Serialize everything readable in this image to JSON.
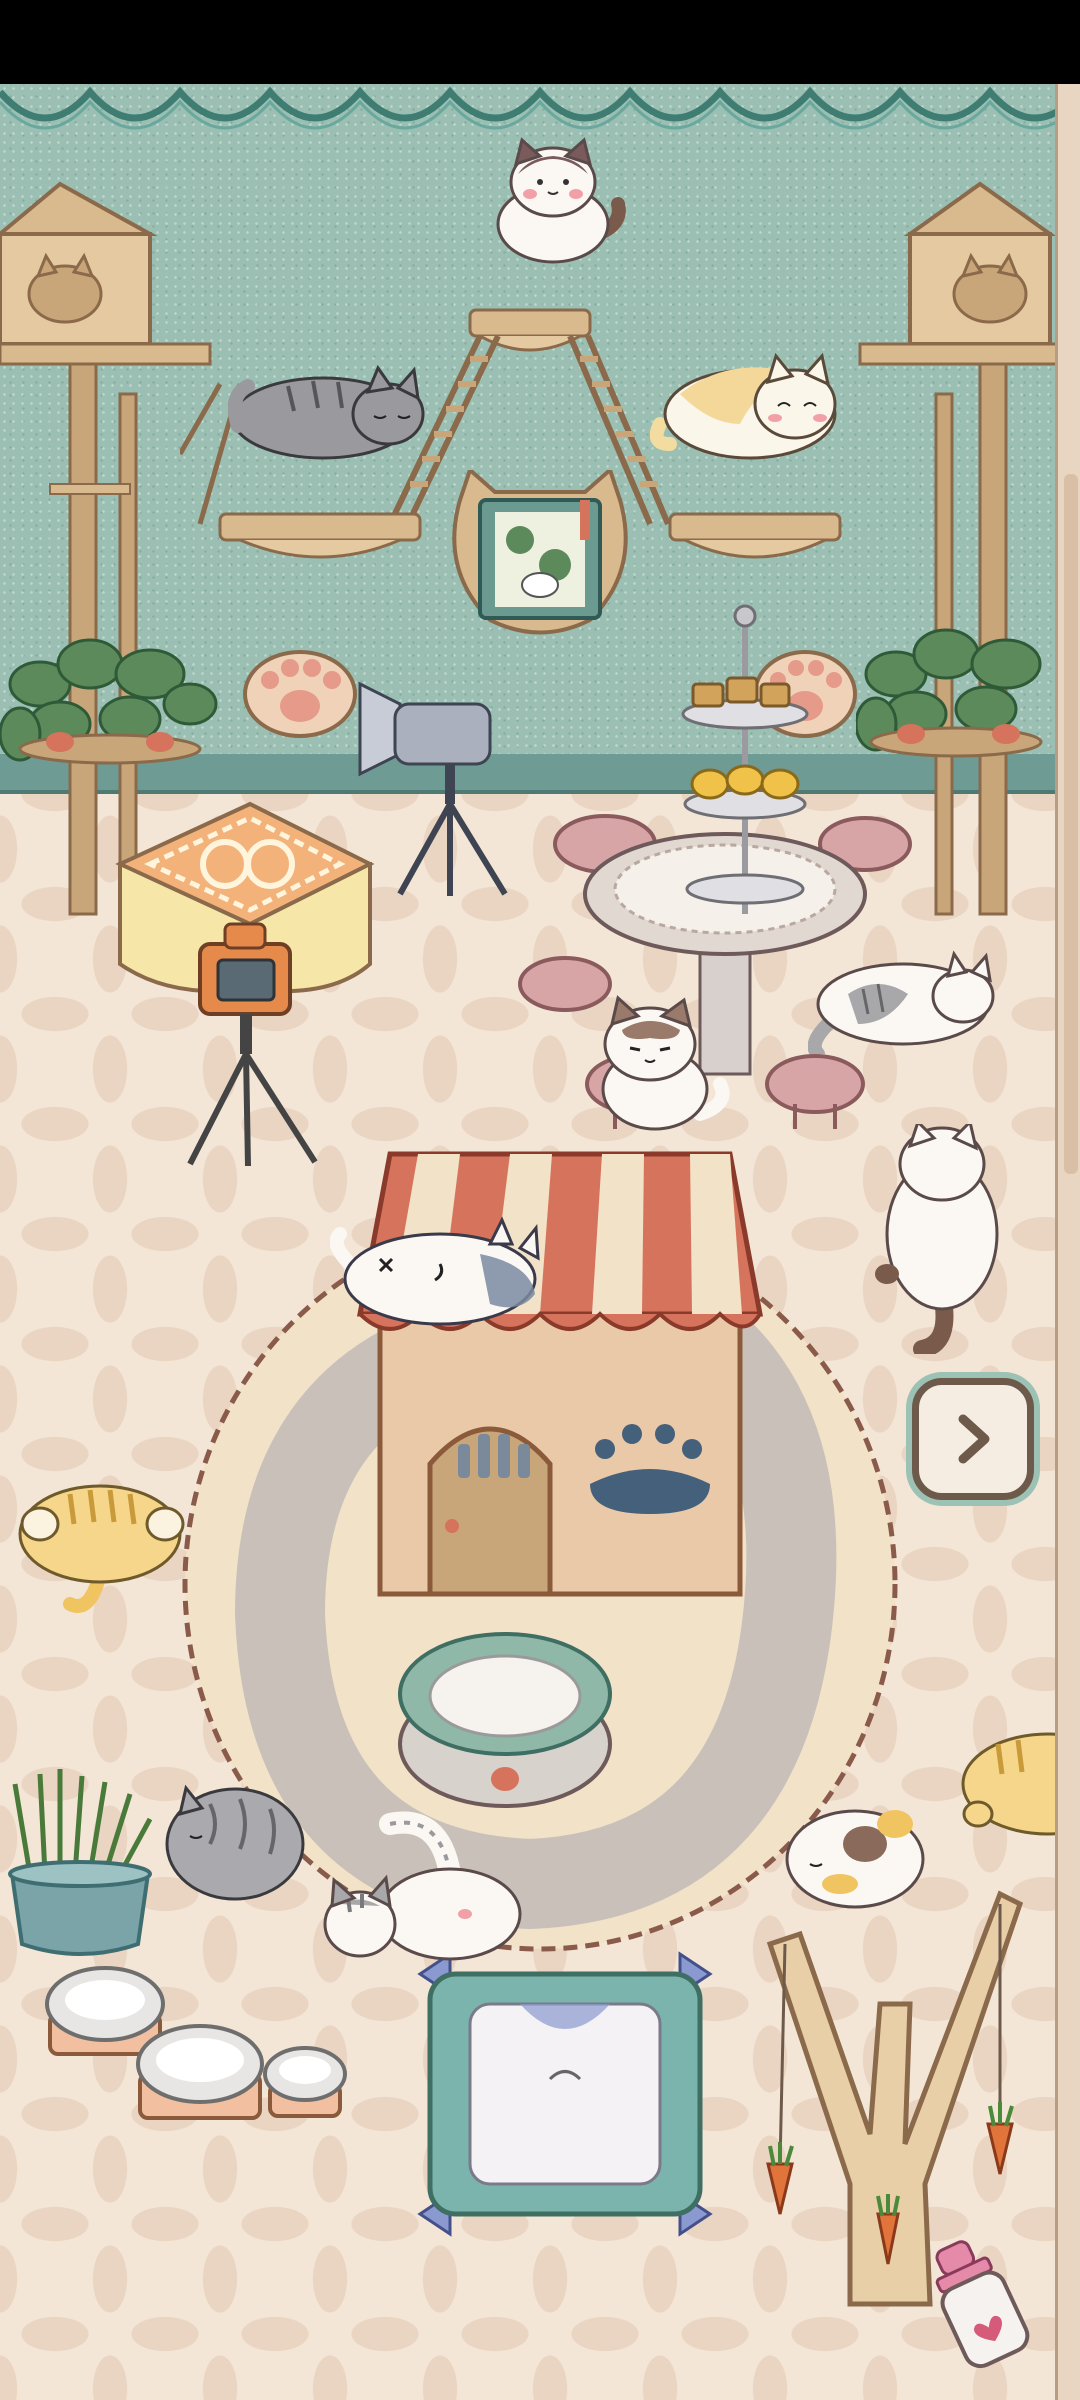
{
  "scene": {
    "name": "cat-cafe-room",
    "colors": {
      "wall": "#9bbfb3",
      "floor": "#f3e6d6",
      "wood": "#d9b98e",
      "wood_dark": "#8a6a4a",
      "pink": "#d8a5a7",
      "awning": "#d6735c",
      "green": "#5c8a5a"
    }
  },
  "controls": {
    "next_button": {
      "icon": "chevron-right-icon"
    }
  },
  "cats": [
    "cat-on-top-perch",
    "cat-sleeping-left-shelf",
    "cat-lying-right-shelf",
    "cat-on-round-table",
    "cat-lying-on-table-edge",
    "cat-sitting-back-view",
    "cat-on-house-roof",
    "cat-tabby-orange-left",
    "cat-grey-ball",
    "cat-white-tabby-playing",
    "cat-calico-curled",
    "cat-yellow-peeking-right"
  ],
  "furniture": [
    "cat-tree-left",
    "cat-tree-right",
    "wall-shelf-ladder",
    "photo-book",
    "potted-plant-left",
    "potted-plant-right",
    "paw-lamp-left",
    "paw-lamp-right",
    "spotlight-camera",
    "square-table",
    "camera-tripod",
    "round-table",
    "pastry-stand",
    "cat-house",
    "round-rug",
    "cat-bed",
    "cat-grass-pot",
    "food-bowls",
    "cushion-bed",
    "branch-toy-with-carrots",
    "milk-bottle"
  ]
}
